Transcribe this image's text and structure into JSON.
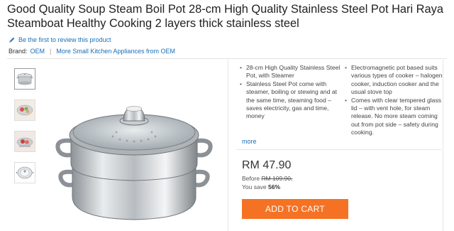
{
  "product": {
    "title": "Good Quality Soup Steam Boil Pot 28-cm High Quality Stainless Steel Pot Hari Raya Steamboat Healthy Cooking 2 layers thick stainless steel",
    "review_link": "Be the first to review this product",
    "brand_label": "Brand:",
    "brand_name": "OEM",
    "brand_more": "More Small Kitchen Appliances from OEM"
  },
  "gallery": {
    "thumbnail_count": 4,
    "active_index": 0
  },
  "description": {
    "column1": [
      "28-cm High Quality Stainless Steel Pot, with Steamer",
      "Stainless Steel Pot come with steamer, boiling or stewing and at the same time, steaming food – saves electricity, gas and time, money"
    ],
    "column2": [
      "Electromagnetic pot based suits various types of cooker – halogen cooker, induction cooker and the usual stove top",
      "Comes with clear tempered glass lid – with vent hole, for steam release. No more steam coming out from pot side – safety during cooking."
    ],
    "more_label": "more"
  },
  "pricing": {
    "price": "RM 47.90",
    "before_label": "Before",
    "before_price": "RM 109.90,",
    "save_label": "You save",
    "save_percent": "56%"
  },
  "actions": {
    "add_to_cart": "ADD TO CART"
  },
  "colors": {
    "accent": "#f57224",
    "link": "#1a6fb5"
  },
  "icons": {
    "review": "pencil-icon"
  }
}
